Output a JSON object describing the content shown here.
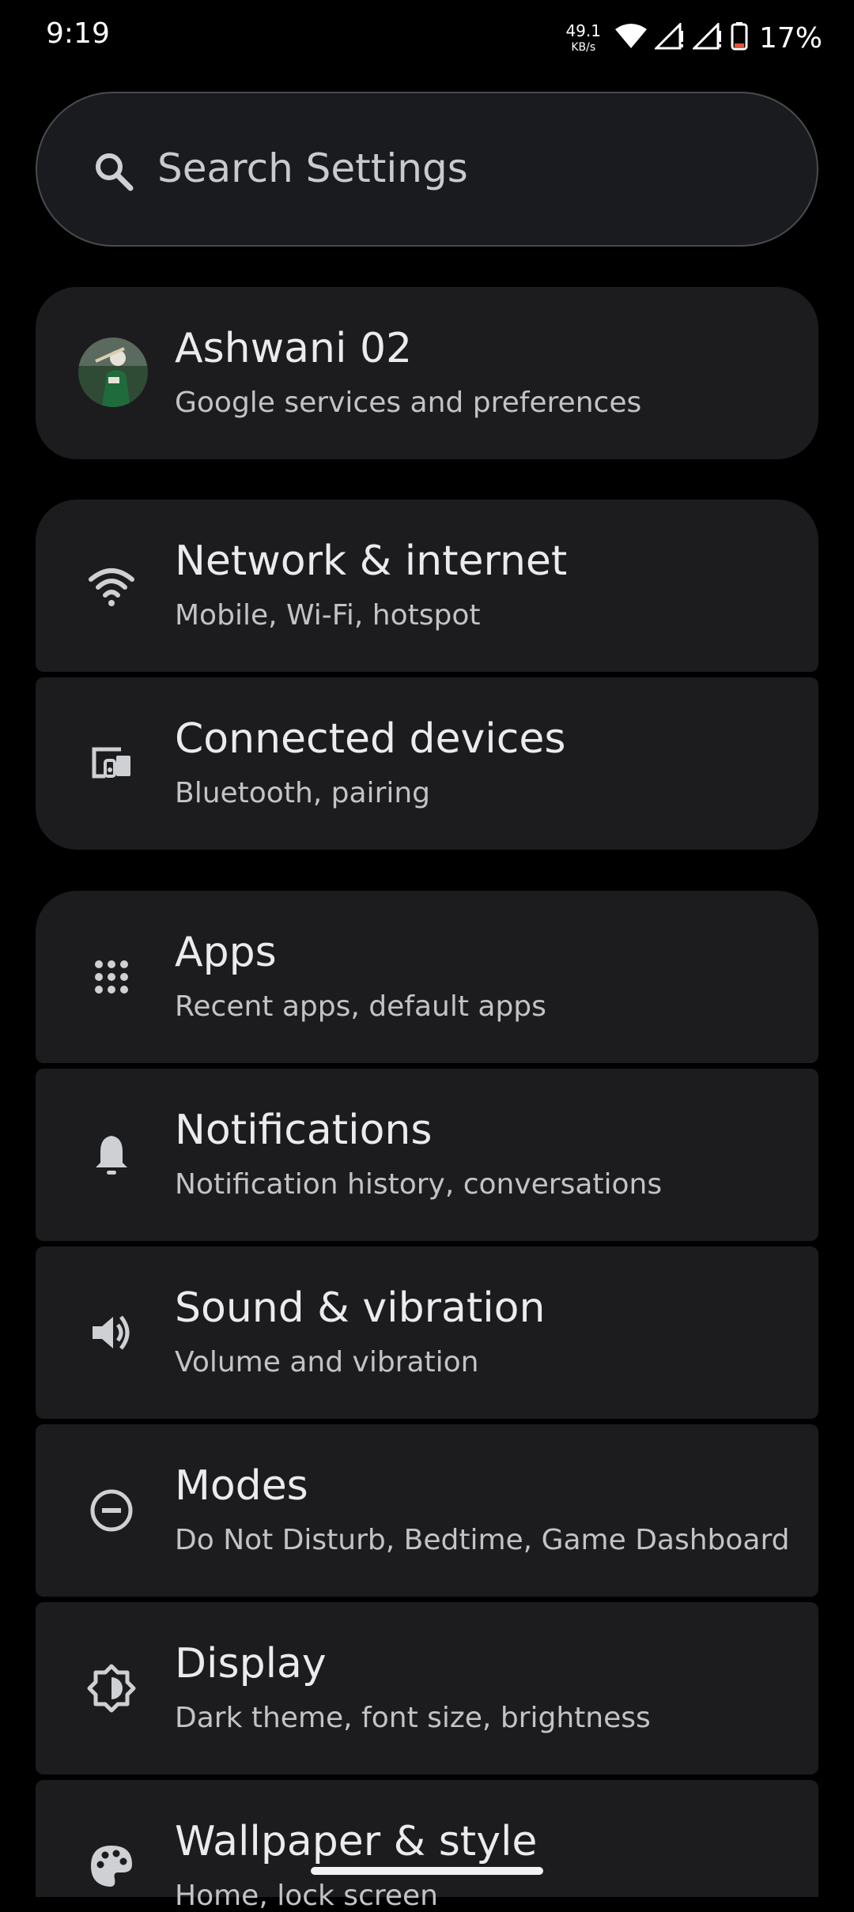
{
  "status_bar": {
    "time": "9:19",
    "net_speed_value": "49.1",
    "net_speed_unit": "KB/s",
    "battery_percent": "17%",
    "icons": [
      "wifi-icon",
      "signal-icon",
      "signal-icon",
      "battery-icon"
    ]
  },
  "search": {
    "placeholder": "Search Settings",
    "icon": "search-icon"
  },
  "account": {
    "name": "Ashwani 02",
    "subtitle": "Google services and preferences"
  },
  "settings": [
    {
      "id": "network",
      "title": "Network & internet",
      "subtitle": "Mobile, Wi-Fi, hotspot",
      "icon": "wifi-icon"
    },
    {
      "id": "connected",
      "title": "Connected devices",
      "subtitle": "Bluetooth, pairing",
      "icon": "devices-icon"
    },
    {
      "id": "apps",
      "title": "Apps",
      "subtitle": "Recent apps, default apps",
      "icon": "apps-grid-icon"
    },
    {
      "id": "notifications",
      "title": "Notifications",
      "subtitle": "Notification history, conversations",
      "icon": "bell-icon"
    },
    {
      "id": "sound",
      "title": "Sound & vibration",
      "subtitle": "Volume and vibration",
      "icon": "speaker-icon"
    },
    {
      "id": "modes",
      "title": "Modes",
      "subtitle": "Do Not Disturb, Bedtime, Game Dashboard",
      "icon": "minus-circle-icon"
    },
    {
      "id": "display",
      "title": "Display",
      "subtitle": "Dark theme, font size, brightness",
      "icon": "brightness-icon"
    },
    {
      "id": "wallpaper",
      "title": "Wallpaper & style",
      "subtitle": "Home, lock screen",
      "icon": "palette-icon"
    }
  ],
  "colors": {
    "background": "#000000",
    "card": "#1c1c1e",
    "battery_low": "#e5533d"
  }
}
